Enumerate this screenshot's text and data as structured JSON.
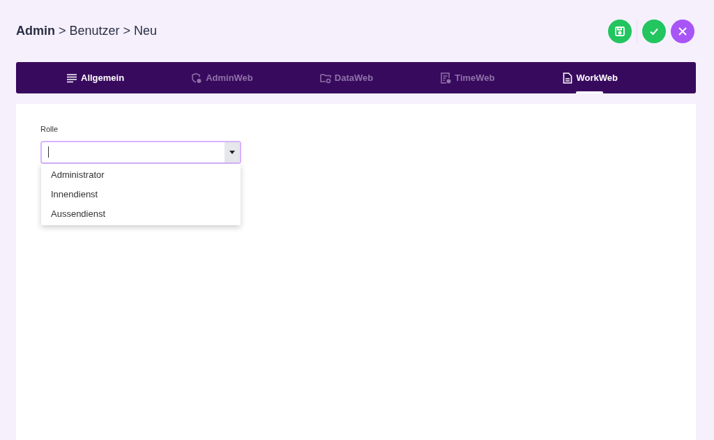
{
  "breadcrumb": "**Admin** > Benutzer > Neu",
  "tabs": [
    {
      "label": "Allgemein",
      "selected": false,
      "disabled": false
    },
    {
      "label": "AdminWeb",
      "selected": false,
      "disabled": true
    },
    {
      "label": "DataWeb",
      "selected": false,
      "disabled": true
    },
    {
      "label": "TimeWeb",
      "selected": false,
      "disabled": true
    },
    {
      "label": "WorkWeb",
      "selected": true,
      "disabled": false
    }
  ],
  "form": {
    "label": "Rolle",
    "expanded": true,
    "options": [
      "Administrator",
      "Innendienst",
      "Aussendienst"
    ]
  }
}
